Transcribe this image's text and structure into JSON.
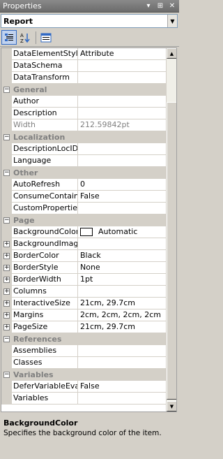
{
  "window": {
    "title": "Properties",
    "buttons": [
      "▾",
      "⊞",
      "✕"
    ]
  },
  "object_selector": {
    "value": "Report"
  },
  "toolbar": {
    "categorized_tip": "Categorized",
    "alpha_tip": "Alphabetical",
    "pages_tip": "Property Pages"
  },
  "rows": [
    {
      "type": "prop",
      "name": "DataElementStyle",
      "value": "Attribute"
    },
    {
      "type": "prop",
      "name": "DataSchema",
      "value": ""
    },
    {
      "type": "prop",
      "name": "DataTransform",
      "value": ""
    },
    {
      "type": "cat",
      "name": "General"
    },
    {
      "type": "prop",
      "name": "Author",
      "value": ""
    },
    {
      "type": "prop",
      "name": "Description",
      "value": ""
    },
    {
      "type": "prop",
      "name": "Width",
      "value": "212.59842pt",
      "disabled": true
    },
    {
      "type": "cat",
      "name": "Localization"
    },
    {
      "type": "prop",
      "name": "DescriptionLocID",
      "value": ""
    },
    {
      "type": "prop",
      "name": "Language",
      "value": ""
    },
    {
      "type": "cat",
      "name": "Other"
    },
    {
      "type": "prop",
      "name": "AutoRefresh",
      "value": "0"
    },
    {
      "type": "prop",
      "name": "ConsumeContainer",
      "value": "False"
    },
    {
      "type": "prop",
      "name": "CustomProperties",
      "value": ""
    },
    {
      "type": "cat",
      "name": "Page"
    },
    {
      "type": "prop",
      "name": "BackgroundColor",
      "value": "Automatic",
      "swatch": "#ffffff",
      "selected": true
    },
    {
      "type": "prop",
      "name": "BackgroundImage",
      "value": "",
      "expandable": true
    },
    {
      "type": "prop",
      "name": "BorderColor",
      "value": "Black",
      "expandable": true
    },
    {
      "type": "prop",
      "name": "BorderStyle",
      "value": "None",
      "expandable": true
    },
    {
      "type": "prop",
      "name": "BorderWidth",
      "value": "1pt",
      "expandable": true
    },
    {
      "type": "prop",
      "name": "Columns",
      "value": "",
      "expandable": true
    },
    {
      "type": "prop",
      "name": "InteractiveSize",
      "value": "21cm, 29.7cm",
      "expandable": true
    },
    {
      "type": "prop",
      "name": "Margins",
      "value": "2cm, 2cm, 2cm, 2cm",
      "expandable": true
    },
    {
      "type": "prop",
      "name": "PageSize",
      "value": "21cm, 29.7cm",
      "expandable": true
    },
    {
      "type": "cat",
      "name": "References"
    },
    {
      "type": "prop",
      "name": "Assemblies",
      "value": ""
    },
    {
      "type": "prop",
      "name": "Classes",
      "value": ""
    },
    {
      "type": "cat",
      "name": "Variables"
    },
    {
      "type": "prop",
      "name": "DeferVariableEvalu",
      "value": "False"
    },
    {
      "type": "prop",
      "name": "Variables",
      "value": ""
    }
  ],
  "help": {
    "title": "BackgroundColor",
    "description": "Specifies the background color of the item."
  }
}
